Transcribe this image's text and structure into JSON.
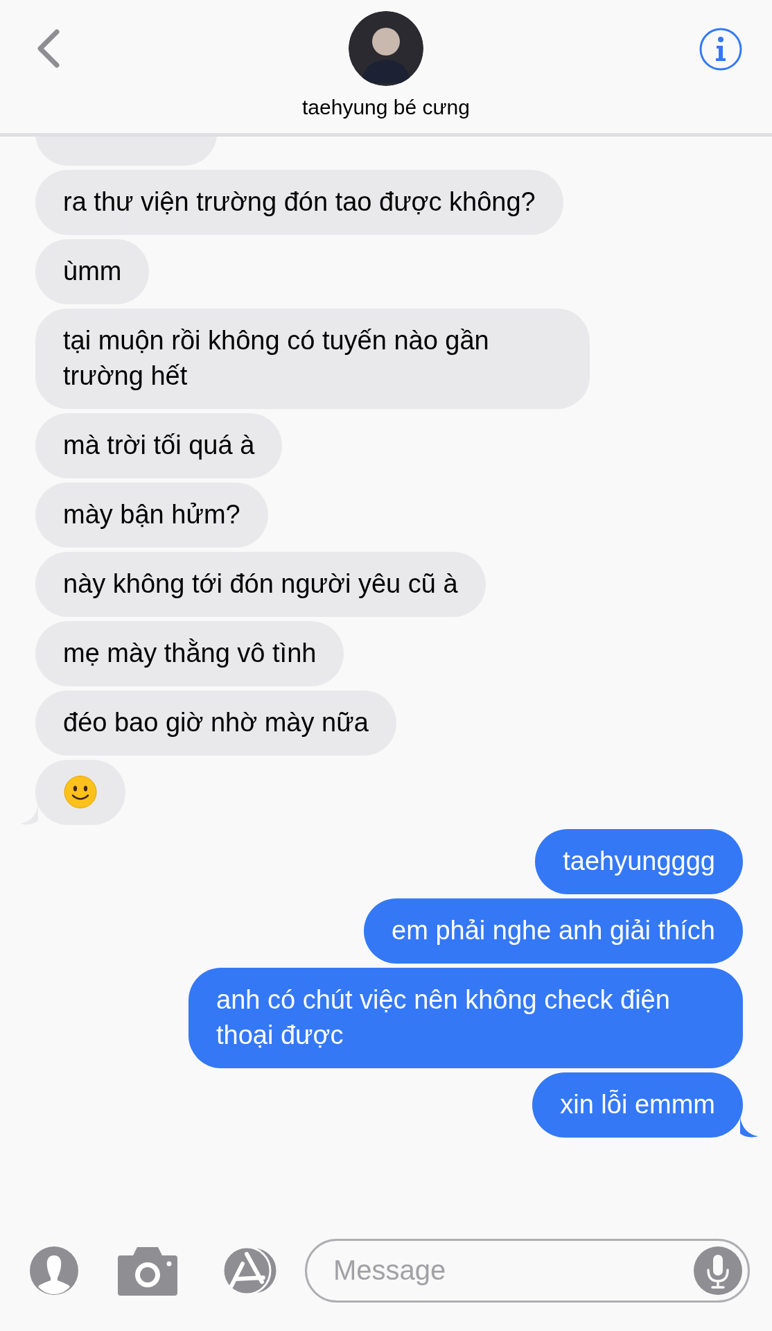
{
  "header": {
    "contact_name": "taehyung bé cưng"
  },
  "received_messages": [
    {
      "kind": "cut"
    },
    {
      "kind": "text",
      "text": "ra thư viện trường đón tao được không?",
      "tail": false
    },
    {
      "kind": "text",
      "text": "ùmm",
      "tail": false
    },
    {
      "kind": "text",
      "text": "tại muộn rồi không có tuyến nào gần trường hết",
      "tail": false
    },
    {
      "kind": "text",
      "text": "mà trời tối quá à",
      "tail": false
    },
    {
      "kind": "text",
      "text": "mày bận hửm?",
      "tail": false
    },
    {
      "kind": "text",
      "text": "này không tới đón người yêu cũ à",
      "tail": false
    },
    {
      "kind": "text",
      "text": "mẹ mày thằng vô tình",
      "tail": false
    },
    {
      "kind": "text",
      "text": "đéo bao giờ nhờ mày nữa",
      "tail": false
    },
    {
      "kind": "emoji",
      "tail": true
    }
  ],
  "sent_messages": [
    {
      "kind": "text",
      "text": "taehyungggg",
      "tail": false
    },
    {
      "kind": "text",
      "text": "em phải nghe anh giải thích",
      "tail": false
    },
    {
      "kind": "text",
      "text": "anh có chút việc nên không check điện thoại được",
      "tail": false
    },
    {
      "kind": "text",
      "text": "xin lỗi emmm",
      "tail": true
    }
  ],
  "composer": {
    "placeholder": "Message"
  }
}
